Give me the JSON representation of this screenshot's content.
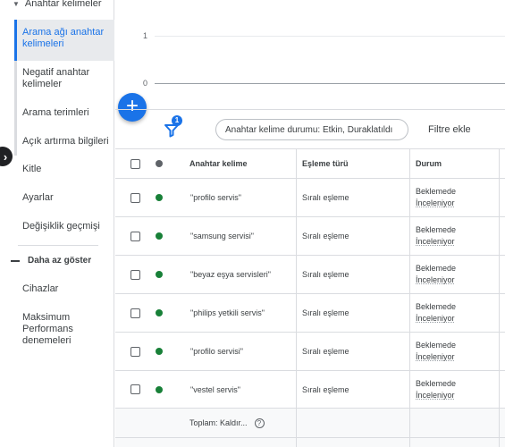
{
  "sidebar": {
    "section_label": "Anahtar kelimeler",
    "items": [
      {
        "label": "Arama ağı anahtar kelimeleri"
      },
      {
        "label": "Negatif anahtar kelimeler"
      },
      {
        "label": "Arama terimleri"
      },
      {
        "label": "Açık artırma bilgileri"
      },
      {
        "label": "Kitle"
      },
      {
        "label": "Ayarlar"
      },
      {
        "label": "Değişiklik geçmişi"
      }
    ],
    "show_less": "Daha az göster",
    "extra_items": [
      {
        "label": "Cihazlar"
      },
      {
        "label": "Maksimum Performans denemeleri"
      }
    ]
  },
  "chart": {
    "ticks": [
      "1",
      "0"
    ]
  },
  "filter": {
    "badge": "1",
    "chip": "Anahtar kelime durumu: Etkin, Duraklatıldı",
    "add": "Filtre ekle"
  },
  "table": {
    "headers": {
      "keyword": "Anahtar kelime",
      "match_type": "Eşleme türü",
      "status": "Durum"
    },
    "rows": [
      {
        "keyword": "\"profilo servis\"",
        "match_type": "Sıralı eşleme",
        "status_line1": "Beklemede",
        "status_line2": "İnceleniyor"
      },
      {
        "keyword": "\"samsung servisi\"",
        "match_type": "Sıralı eşleme",
        "status_line1": "Beklemede",
        "status_line2": "İnceleniyor"
      },
      {
        "keyword": "\"beyaz eşya servisleri\"",
        "match_type": "Sıralı eşleme",
        "status_line1": "Beklemede",
        "status_line2": "İnceleniyor"
      },
      {
        "keyword": "\"philips yetkili servis\"",
        "match_type": "Sıralı eşleme",
        "status_line1": "Beklemede",
        "status_line2": "İnceleniyor"
      },
      {
        "keyword": "\"profilo servisi\"",
        "match_type": "Sıralı eşleme",
        "status_line1": "Beklemede",
        "status_line2": "İnceleniyor"
      },
      {
        "keyword": "\"vestel servis\"",
        "match_type": "Sıralı eşleme",
        "status_line1": "Beklemede",
        "status_line2": "İnceleniyor"
      }
    ],
    "total": "Toplam: Kaldır..."
  },
  "colors": {
    "accent": "#1a73e8",
    "enabled_dot": "#188038",
    "header_dot": "#5f6368"
  }
}
